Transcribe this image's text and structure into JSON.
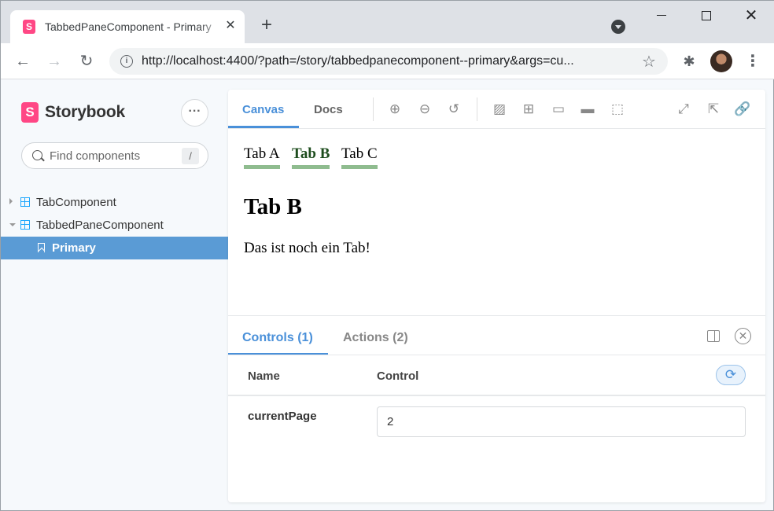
{
  "browser": {
    "tab_title": "TabbedPaneComponent - Primary",
    "tab_close": "✕",
    "new_tab": "+",
    "url": "http://localhost:4400/?path=/story/tabbedpanecomponent--primary&args=cu...",
    "icons": [
      "back-icon",
      "forward-icon",
      "reload-icon",
      "info-icon",
      "star-icon",
      "extensions-icon",
      "profile-avatar",
      "menu-icon"
    ]
  },
  "sidebar": {
    "logo_mark": "S",
    "logo_text": "Storybook",
    "search_placeholder": "Find components",
    "search_shortcut": "/",
    "items": [
      {
        "label": "TabComponent",
        "expanded": false
      },
      {
        "label": "TabbedPaneComponent",
        "expanded": true
      },
      {
        "label": "Primary",
        "selected": true
      }
    ]
  },
  "toolbar": {
    "tabs": [
      "Canvas",
      "Docs"
    ],
    "active_tab": "Canvas",
    "tools": [
      "zoom-in-icon",
      "zoom-out-icon",
      "zoom-reset-icon",
      "background-icon",
      "grid-icon",
      "viewport-icon",
      "measure-icon",
      "outline-icon",
      "fullscreen-icon",
      "open-new-tab-icon",
      "copy-link-icon"
    ]
  },
  "preview": {
    "tabs": [
      "Tab A",
      "Tab B",
      "Tab C"
    ],
    "active_tab": "Tab B",
    "heading": "Tab B",
    "text": "Das ist noch ein Tab!"
  },
  "addons": {
    "tabs": [
      "Controls (1)",
      "Actions (2)"
    ],
    "active_tab": "Controls (1)",
    "header_name": "Name",
    "header_control": "Control",
    "rows": [
      {
        "name": "currentPage",
        "value": "2"
      }
    ]
  },
  "colors": {
    "accent": "#4a90d9",
    "storybook_pink": "#ff4785",
    "selected_item": "#5a9bd5",
    "demo_tab_underline": "#8fbc8f"
  }
}
